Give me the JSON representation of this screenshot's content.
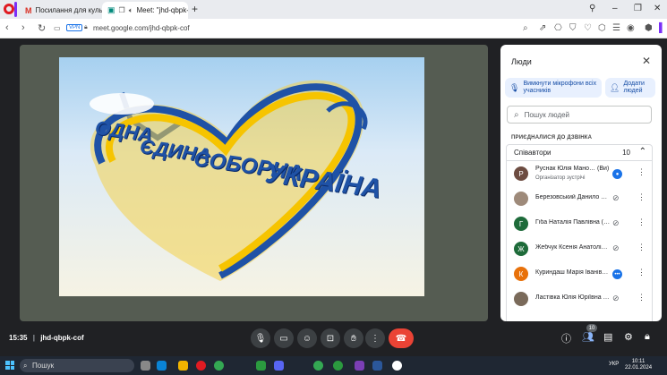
{
  "browser": {
    "tabs": [
      {
        "label": "Посилання для культуро",
        "icon": "gmail-icon"
      },
      {
        "label": "Meet: \"jhd-qbpk-",
        "icon": "meet-icon"
      }
    ],
    "new_tab": "+",
    "vpn": "VPN",
    "url": "meet.google.com/jhd-qbpk-cof"
  },
  "video": {
    "line1": "ОДНА",
    "line2": "ЄДИНА",
    "line3": "СОБОРНА",
    "line4": "УКРАЇНА"
  },
  "panel": {
    "title": "Люди",
    "mute_all": "Вимкнути мікрофони всіх учасників",
    "add_people": "Додати людей",
    "search_placeholder": "Пошук людей",
    "joined_label": "ПРИЄДНАЛИСЯ ДО ДЗВІНКА",
    "section_title": "Співавтори",
    "section_count": "10",
    "participants": [
      {
        "initial": "Р",
        "name": "Руснак Юлія Мано… (Ви)",
        "role": "Організатор зустрічі",
        "color": "#6d4c41",
        "mic": "live"
      },
      {
        "initial": "",
        "name": "Березовський Данило …",
        "role": "",
        "color": "#9e8a7a",
        "mic": "muted"
      },
      {
        "initial": "Г",
        "name": "Гіба Наталія Павлівна (…",
        "role": "",
        "color": "#1e6b3a",
        "mic": "muted"
      },
      {
        "initial": "Ж",
        "name": "Жебчук Ксенія Анатолі…",
        "role": "",
        "color": "#1e6b3a",
        "mic": "muted"
      },
      {
        "initial": "К",
        "name": "Куриндаш Марія Іванів…",
        "role": "",
        "color": "#e8710a",
        "mic": "live"
      },
      {
        "initial": "",
        "name": "Ластівка Юлія Юріївна …",
        "role": "",
        "color": "#7a6a5a",
        "mic": "muted"
      }
    ]
  },
  "controls": {
    "time": "15:35",
    "separator": "|",
    "meeting_code": "jhd-qbpk-cof",
    "people_count": "10"
  },
  "taskbar": {
    "search": "Пошук",
    "lang": "УКР",
    "time": "10:11",
    "date": "22.01.2024"
  }
}
